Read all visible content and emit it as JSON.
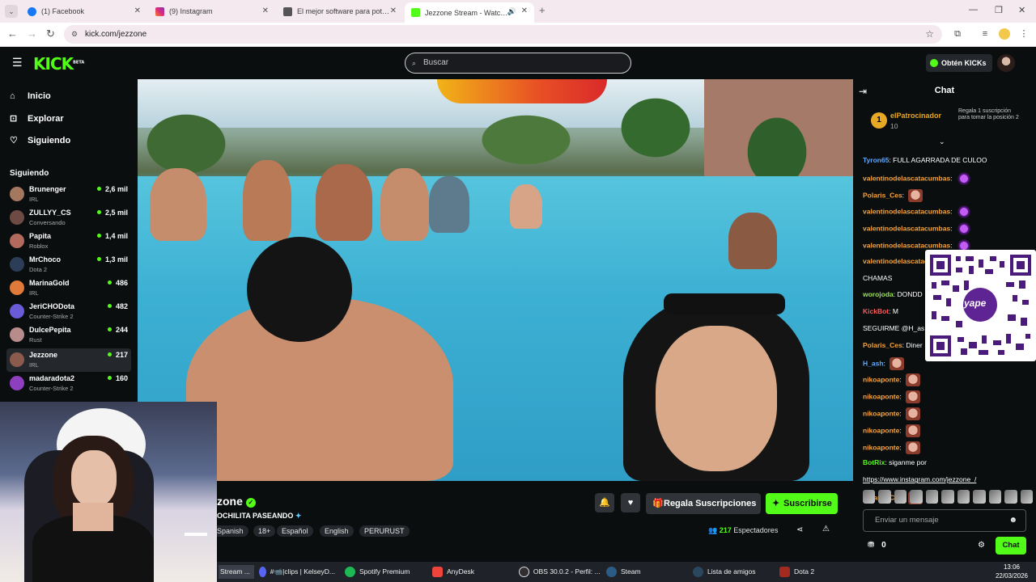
{
  "browser": {
    "tabs": [
      {
        "label": "(1) Facebook",
        "color": "#1877f2"
      },
      {
        "label": "(9) Instagram",
        "color": "#d6249f"
      },
      {
        "label": "El mejor software para potenciar",
        "color": "#555555"
      },
      {
        "label": "Jezzone Stream - Watch Live",
        "color": "#53fc18"
      }
    ],
    "url": "kick.com/jezzone"
  },
  "kick": {
    "search_placeholder": "Buscar",
    "get_kicks": "Obtén KICKs",
    "brand_color": "#53fc18"
  },
  "sidebar": {
    "nav": [
      {
        "label": "Inicio",
        "icon": "home-icon"
      },
      {
        "label": "Explorar",
        "icon": "compass-icon"
      },
      {
        "label": "Siguiendo",
        "icon": "heart-icon"
      }
    ],
    "following_heading": "Siguiendo",
    "following": [
      {
        "name": "Brunenger",
        "category": "IRL",
        "viewers": "2,6 mil",
        "color": "#a3785f"
      },
      {
        "name": "ZULLYY_CS",
        "category": "Conversando",
        "viewers": "2,5 mil",
        "color": "#6d4a43"
      },
      {
        "name": "Papita",
        "category": "Roblox",
        "viewers": "1,4 mil",
        "color": "#b16a5c"
      },
      {
        "name": "MrChoco",
        "category": "Dota 2",
        "viewers": "1,3 mil",
        "color": "#2c3e57"
      },
      {
        "name": "MarinaGold",
        "category": "IRL",
        "viewers": "486",
        "color": "#e07a3a"
      },
      {
        "name": "JeriCHODota",
        "category": "Counter-Strike 2",
        "viewers": "482",
        "color": "#6a5bd6"
      },
      {
        "name": "DulcePepita",
        "category": "Rust",
        "viewers": "244",
        "color": "#b98c8c"
      },
      {
        "name": "Jezzone",
        "category": "IRL",
        "viewers": "217",
        "color": "#8a5b4d"
      },
      {
        "name": "madaradota2",
        "category": "Counter-Strike 2",
        "viewers": "160",
        "color": "#8e3fbf"
      }
    ]
  },
  "stream": {
    "channel": "zone",
    "title": "OCHILITA PASEANDO",
    "tags": [
      "Spanish",
      "18+",
      "Español",
      "English",
      "PERURUST"
    ],
    "gift_label": "Regala Suscripciones",
    "subscribe_label": "Suscribirse",
    "viewer_count": "217",
    "viewer_label": "Espectadores"
  },
  "chat": {
    "title": "Chat",
    "pinned": {
      "rank": "1",
      "user": "elPatrocinador",
      "count": "10",
      "text": "Regala 1 suscripción para tomar la posición 2"
    },
    "messages": [
      {
        "user": "Tyron65",
        "color": "#5ea9ff",
        "text": "FULL AGARRADA DE CULOO",
        "emote": ""
      },
      {
        "user": "valentinodelascatacumbas",
        "color": "#f6a33b",
        "text": "",
        "emote": "purple"
      },
      {
        "user": "Polaris_Ces",
        "color": "#f6a33b",
        "text": "",
        "emote": "face"
      },
      {
        "user": "valentinodelascatacumbas",
        "color": "#f6a33b",
        "text": "",
        "emote": "purple"
      },
      {
        "user": "valentinodelascatacumbas",
        "color": "#f6a33b",
        "text": "",
        "emote": "purple"
      },
      {
        "user": "valentinodelascatacumbas",
        "color": "#f6a33b",
        "text": "",
        "emote": "purple"
      },
      {
        "user": "valentinodelascatac",
        "color": "#f6a33b",
        "text": "",
        "emote": ""
      },
      {
        "user": "",
        "color": "#ffffff",
        "text": "CHAMAS",
        "emote": ""
      },
      {
        "user": "worojoda",
        "color": "#9be05a",
        "text": "DONDD",
        "emote": ""
      },
      {
        "user": "KickBot",
        "color": "#ff5a5a",
        "text": "M",
        "emote": ""
      },
      {
        "user": "",
        "color": "#ffffff",
        "text": "SEGUIRME @H_as",
        "emote": ""
      },
      {
        "user": "Polaris_Ces",
        "color": "#f6a33b",
        "text": "Diner",
        "emote": ""
      },
      {
        "user": "H_ash",
        "color": "#5ea9ff",
        "text": "",
        "emote": "face"
      },
      {
        "user": "nikoaponte",
        "color": "#f6a33b",
        "text": "",
        "emote": "face"
      },
      {
        "user": "nikoaponte",
        "color": "#f6a33b",
        "text": "",
        "emote": "face"
      },
      {
        "user": "nikoaponte",
        "color": "#f6a33b",
        "text": "",
        "emote": "face"
      },
      {
        "user": "nikoaponte",
        "color": "#f6a33b",
        "text": "",
        "emote": "face"
      },
      {
        "user": "nikoaponte",
        "color": "#f6a33b",
        "text": "",
        "emote": "face"
      },
      {
        "user": "BotRix",
        "color": "#53fc18",
        "text": "siganme por",
        "emote": ""
      },
      {
        "user": "",
        "color": "#ffffff",
        "text": "https://www.instagram.com/jezzone_/",
        "emote": ""
      },
      {
        "user": "Polaris_Ces",
        "color": "#f6a33b",
        "text": "",
        "emote": "face"
      }
    ],
    "input_placeholder": "Enviar un mensaje",
    "kicks_balance": "0",
    "send_label": "Chat"
  },
  "overlay": {
    "qr_brand": "yape"
  },
  "taskbar": {
    "items": [
      {
        "label": "Stream ...",
        "color": "#3a3f4a"
      },
      {
        "label": "#📹|clips | KelseyD...",
        "color": "#5865f2"
      },
      {
        "label": "Spotify Premium",
        "color": "#1db954"
      },
      {
        "label": "AnyDesk",
        "color": "#ef443b"
      },
      {
        "label": "OBS 30.0.2 - Perfil: ...",
        "color": "#302e31"
      },
      {
        "label": "Steam",
        "color": "#1b2838"
      },
      {
        "label": "Lista de amigos",
        "color": "#2a475e"
      },
      {
        "label": "Dota 2",
        "color": "#a22a1f"
      }
    ],
    "time": "13:06",
    "date": "22/03/2026"
  }
}
